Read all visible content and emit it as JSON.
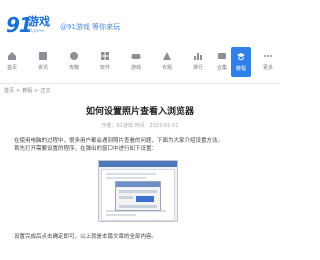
{
  "header": {
    "logo_number": "91",
    "logo_text": "游戏",
    "logo_sub": "91game",
    "slogan": "@91游戏 等你来玩"
  },
  "nav": {
    "items": [
      {
        "label": "首页",
        "icon": "home-icon"
      },
      {
        "label": "资讯",
        "icon": "news-icon"
      },
      {
        "label": "攻略",
        "icon": "guide-icon"
      },
      {
        "label": "软件",
        "icon": "app-icon"
      },
      {
        "label": "游戏",
        "icon": "game-icon"
      },
      {
        "label": "专题",
        "icon": "topic-icon"
      },
      {
        "label": "排行",
        "icon": "rank-icon"
      },
      {
        "label": "合集",
        "icon": "collection-icon"
      },
      {
        "label": "教程",
        "icon": "tutorial-icon",
        "active": true
      },
      {
        "label": "更多",
        "icon": "more-icon"
      }
    ],
    "accent": "#2f80e8"
  },
  "breadcrumb": [
    "首页",
    ">",
    "教程",
    ">",
    "正文"
  ],
  "article": {
    "title": "如何设置照片查看入浏览器",
    "meta": "作者：91游戏  时间：2023-01-01",
    "para1": "在使用电脑的过程中，很多用户都会遇到照片查看的问题，下面为大家介绍设置方法。",
    "para2": "首先打开需要设置的程序，在弹出的窗口中进行如下设置：",
    "para3": "设置完成后点击确定即可，以上就是本篇文章的全部内容。"
  }
}
